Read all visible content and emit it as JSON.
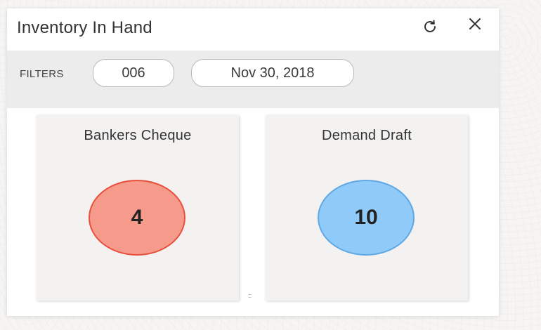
{
  "widget": {
    "title": "Inventory In Hand",
    "icons": {
      "refresh": "refresh-icon",
      "close": "close-icon"
    }
  },
  "filters": {
    "label": "FILTERS",
    "chips": [
      {
        "value": "006"
      },
      {
        "value": "Nov 30, 2018"
      }
    ]
  },
  "cards": [
    {
      "title": "Bankers Cheque",
      "count": "4",
      "color": "#f69a8b",
      "border": "#e8503c"
    },
    {
      "title": "Demand Draft",
      "count": "10",
      "color": "#8fcaf8",
      "border": "#5fa8e6"
    }
  ]
}
